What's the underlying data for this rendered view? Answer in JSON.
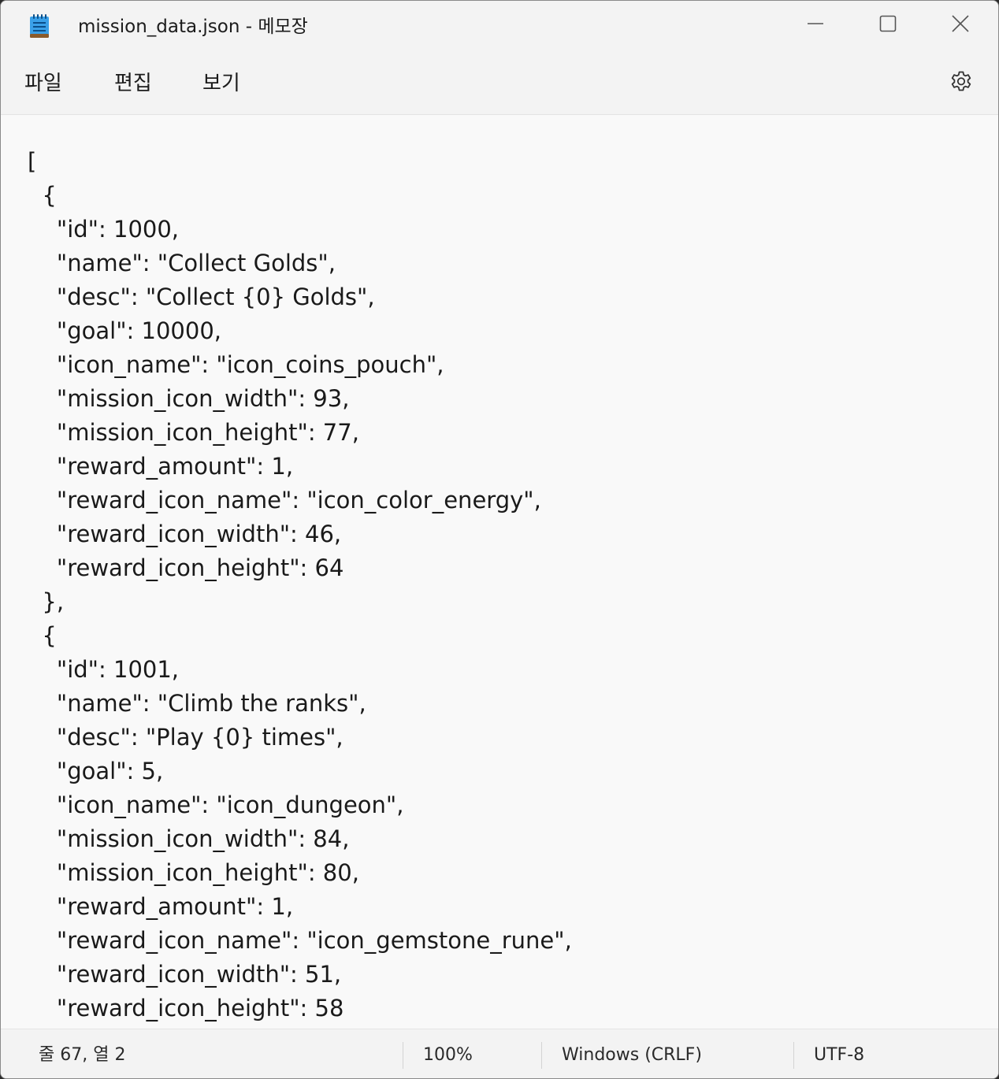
{
  "window": {
    "title": "mission_data.json - 메모장",
    "app_icon": "notepad-icon",
    "controls": {
      "minimize_icon": "minimize-icon",
      "maximize_icon": "maximize-icon",
      "close_icon": "close-icon"
    }
  },
  "menu": {
    "file": "파일",
    "edit": "편집",
    "view": "보기",
    "settings_icon": "gear-icon"
  },
  "editor": {
    "lines": [
      "[",
      "  {",
      "    \"id\": 1000,",
      "    \"name\": \"Collect Golds\",",
      "    \"desc\": \"Collect {0} Golds\",",
      "    \"goal\": 10000,",
      "    \"icon_name\": \"icon_coins_pouch\",",
      "    \"mission_icon_width\": 93,",
      "    \"mission_icon_height\": 77,",
      "    \"reward_amount\": 1,",
      "    \"reward_icon_name\": \"icon_color_energy\",",
      "    \"reward_icon_width\": 46,",
      "    \"reward_icon_height\": 64",
      "  },",
      "  {",
      "    \"id\": 1001,",
      "    \"name\": \"Climb the ranks\",",
      "    \"desc\": \"Play {0} times\",",
      "    \"goal\": 5,",
      "    \"icon_name\": \"icon_dungeon\",",
      "    \"mission_icon_width\": 84,",
      "    \"mission_icon_height\": 80,",
      "    \"reward_amount\": 1,",
      "    \"reward_icon_name\": \"icon_gemstone_rune\",",
      "    \"reward_icon_width\": 51,",
      "    \"reward_icon_height\": 58"
    ]
  },
  "status": {
    "position": "줄 67, 열 2",
    "zoom": "100%",
    "line_ending": "Windows (CRLF)",
    "encoding": "UTF-8"
  }
}
